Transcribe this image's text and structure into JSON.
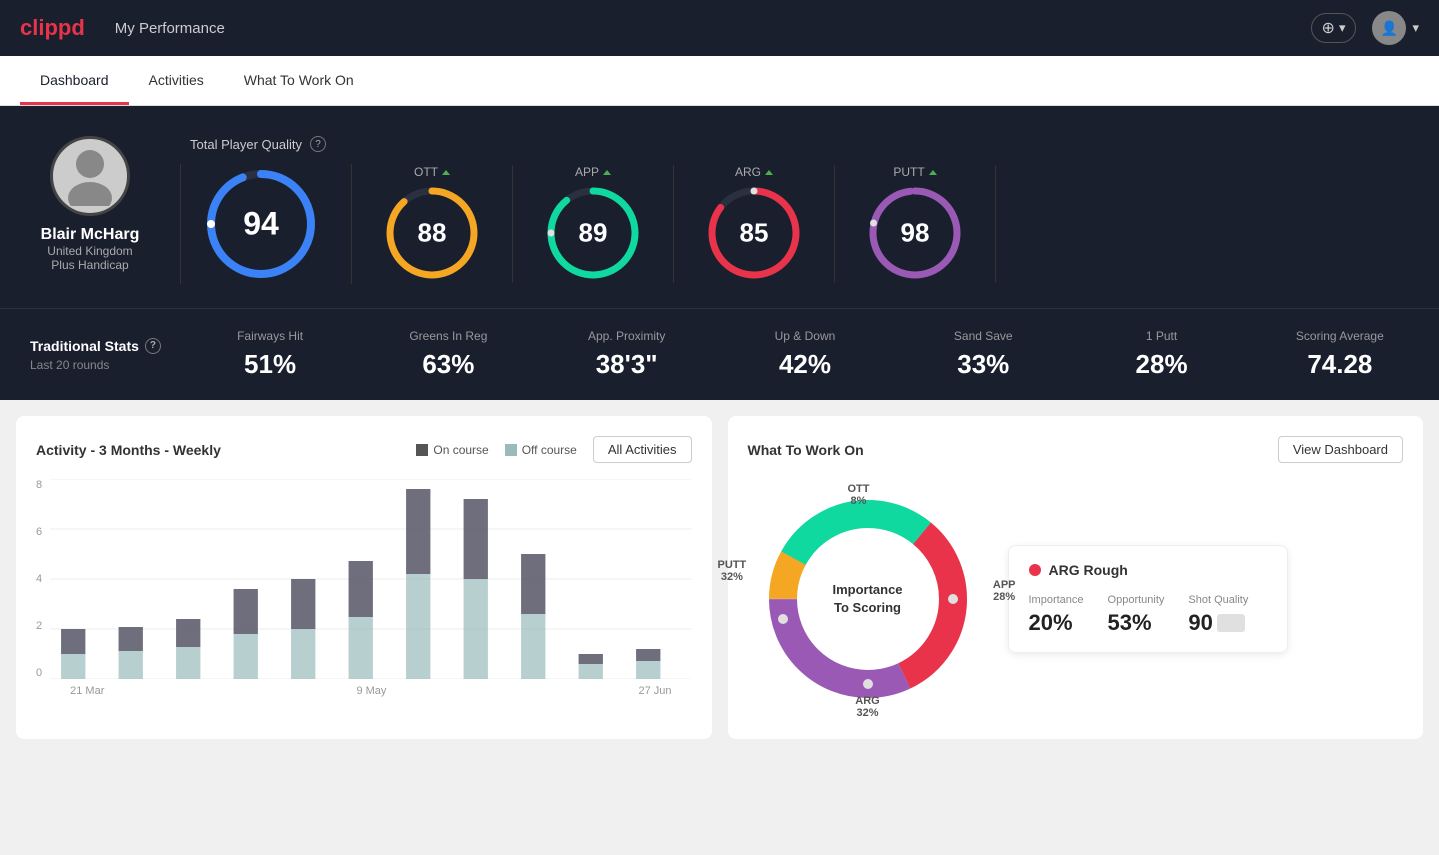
{
  "app": {
    "logo": "clippd",
    "nav_title": "My Performance",
    "add_button": "+ ▾",
    "user_chevron": "▾"
  },
  "tabs": [
    {
      "label": "Dashboard",
      "active": true
    },
    {
      "label": "Activities",
      "active": false
    },
    {
      "label": "What To Work On",
      "active": false
    }
  ],
  "player": {
    "name": "Blair McHarg",
    "country": "United Kingdom",
    "handicap": "Plus Handicap",
    "avatar_initial": "👤"
  },
  "total_quality": {
    "title": "Total Player Quality",
    "score": "94",
    "color": "#3b82f6"
  },
  "gauges": [
    {
      "label": "OTT",
      "score": "88",
      "color": "#f5a623",
      "pct": 88
    },
    {
      "label": "APP",
      "score": "89",
      "color": "#10d9a0",
      "pct": 89
    },
    {
      "label": "ARG",
      "score": "85",
      "color": "#e8334a",
      "pct": 85
    },
    {
      "label": "PUTT",
      "score": "98",
      "color": "#9b59b6",
      "pct": 98
    }
  ],
  "trad_stats": {
    "title": "Traditional Stats",
    "subtitle": "Last 20 rounds",
    "items": [
      {
        "name": "Fairways Hit",
        "value": "51%"
      },
      {
        "name": "Greens In Reg",
        "value": "63%"
      },
      {
        "name": "App. Proximity",
        "value": "38'3\""
      },
      {
        "name": "Up & Down",
        "value": "42%"
      },
      {
        "name": "Sand Save",
        "value": "33%"
      },
      {
        "name": "1 Putt",
        "value": "28%"
      },
      {
        "name": "Scoring Average",
        "value": "74.28"
      }
    ]
  },
  "activity_chart": {
    "title": "Activity - 3 Months - Weekly",
    "legend_on": "On course",
    "legend_off": "Off course",
    "all_button": "All Activities",
    "x_labels": [
      "21 Mar",
      "9 May",
      "27 Jun"
    ],
    "y_labels": [
      "0",
      "2",
      "4",
      "6",
      "8"
    ],
    "bars": [
      {
        "on": 1,
        "off": 1.2
      },
      {
        "on": 1.2,
        "off": 1
      },
      {
        "on": 1.5,
        "off": 1.2
      },
      {
        "on": 2,
        "off": 2
      },
      {
        "on": 2.5,
        "off": 2
      },
      {
        "on": 3,
        "off": 2.5
      },
      {
        "on": 4,
        "off": 5
      },
      {
        "on": 4,
        "off": 4
      },
      {
        "on": 2.5,
        "off": 3
      },
      {
        "on": 0.5,
        "off": 0.5
      },
      {
        "on": 0.7,
        "off": 0.6
      }
    ]
  },
  "what_to_work_on": {
    "title": "What To Work On",
    "view_button": "View Dashboard",
    "donut_center": "Importance\nTo Scoring",
    "segments": [
      {
        "label": "OTT",
        "value": "8%",
        "color": "#f5a623"
      },
      {
        "label": "APP",
        "value": "28%",
        "color": "#10d9a0"
      },
      {
        "label": "ARG",
        "value": "32%",
        "color": "#e8334a"
      },
      {
        "label": "PUTT",
        "value": "32%",
        "color": "#9b59b6"
      }
    ],
    "detail": {
      "title": "ARG Rough",
      "dot_color": "#e8334a",
      "importance_label": "Importance",
      "importance_value": "20%",
      "opportunity_label": "Opportunity",
      "opportunity_value": "53%",
      "shot_quality_label": "Shot Quality",
      "shot_quality_value": "90"
    }
  }
}
